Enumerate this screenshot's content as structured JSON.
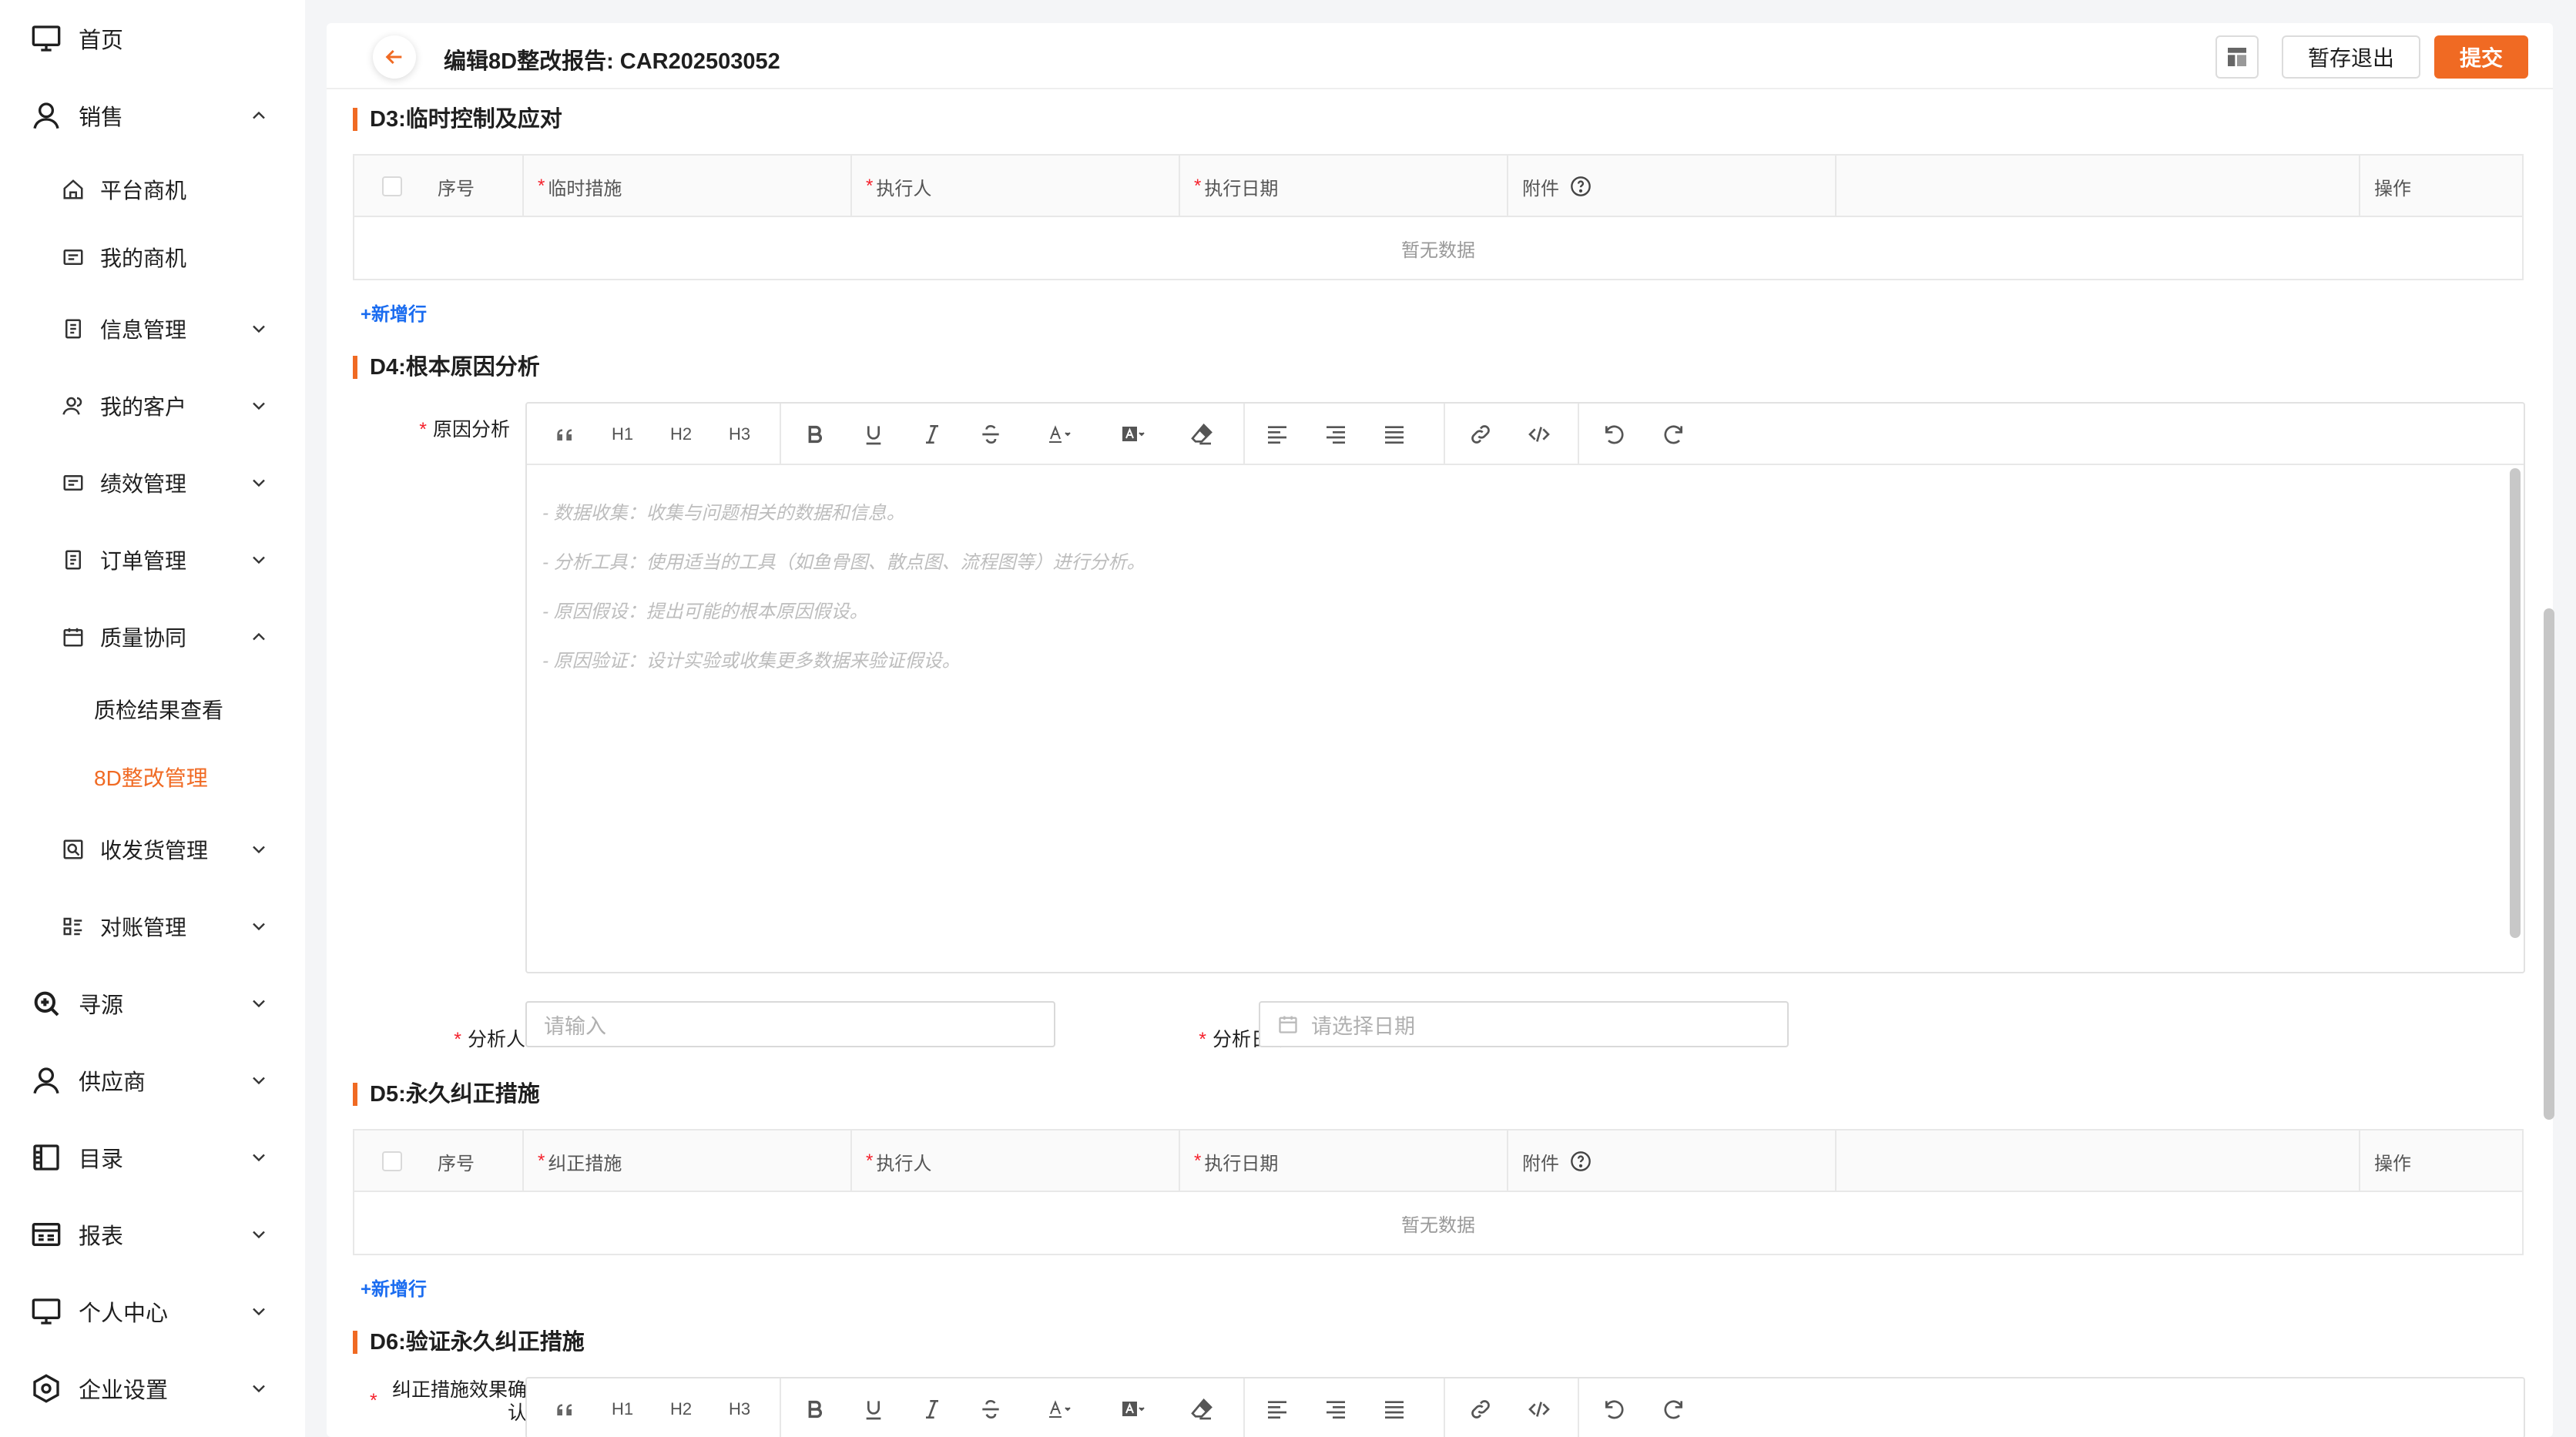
{
  "sidebar": {
    "items": [
      {
        "label": "首页",
        "icon": "monitor-icon"
      },
      {
        "label": "销售",
        "icon": "user-icon",
        "expanded": true
      },
      {
        "label": "平台商机",
        "icon": "home-icon"
      },
      {
        "label": "我的商机",
        "icon": "card-icon"
      },
      {
        "label": "信息管理",
        "icon": "doc-icon"
      },
      {
        "label": "我的客户",
        "icon": "users-icon"
      },
      {
        "label": "绩效管理",
        "icon": "card-icon"
      },
      {
        "label": "订单管理",
        "icon": "doc-icon"
      },
      {
        "label": "质量协同",
        "icon": "calendar-icon",
        "expanded": true
      },
      {
        "label": "质检结果查看"
      },
      {
        "label": "8D整改管理",
        "active": true
      },
      {
        "label": "收发货管理",
        "icon": "search-box-icon"
      },
      {
        "label": "对账管理",
        "icon": "list-icon"
      },
      {
        "label": "寻源",
        "icon": "zoom-icon"
      },
      {
        "label": "供应商",
        "icon": "user-icon"
      },
      {
        "label": "目录",
        "icon": "book-icon"
      },
      {
        "label": "报表",
        "icon": "report-icon"
      },
      {
        "label": "个人中心",
        "icon": "monitor-icon"
      },
      {
        "label": "企业设置",
        "icon": "hex-gear-icon"
      }
    ]
  },
  "header": {
    "title": "编辑8D整改报告: CAR202503052",
    "save_exit_label": "暂存退出",
    "submit_label": "提交"
  },
  "d3": {
    "title": "D3:临时控制及应对",
    "columns": {
      "index": "序号",
      "measure": "临时措施",
      "executor": "执行人",
      "date": "执行日期",
      "attachment": "附件",
      "actions": "操作"
    },
    "empty": "暂无数据",
    "add_row": "+新增行"
  },
  "d4": {
    "title": "D4:根本原因分析",
    "cause_label": "原因分析",
    "toolbar": {
      "h1": "H1",
      "h2": "H2",
      "h3": "H3"
    },
    "placeholder_lines": [
      "- 数据收集：收集与问题相关的数据和信息。",
      "- 分析工具：使用适当的工具（如鱼骨图、散点图、流程图等）进行分析。",
      "- 原因假设：提出可能的根本原因假设。",
      "- 原因验证：设计实验或收集更多数据来验证假设。"
    ],
    "analyst_label": "分析人",
    "analyst_placeholder": "请输入",
    "date_label": "分析日期",
    "date_placeholder": "请选择日期"
  },
  "d5": {
    "title": "D5:永久纠正措施",
    "columns": {
      "index": "序号",
      "measure": "纠正措施",
      "executor": "执行人",
      "date": "执行日期",
      "attachment": "附件",
      "actions": "操作"
    },
    "empty": "暂无数据",
    "add_row": "+新增行"
  },
  "d6": {
    "title": "D6:验证永久纠正措施",
    "effect_label_1": "纠正措施效果确",
    "effect_label_2": "认",
    "toolbar": {
      "h1": "H1",
      "h2": "H2",
      "h3": "H3"
    }
  },
  "colors": {
    "accent": "#f06a23",
    "link": "#1a6cf0",
    "required": "#f5222d"
  }
}
